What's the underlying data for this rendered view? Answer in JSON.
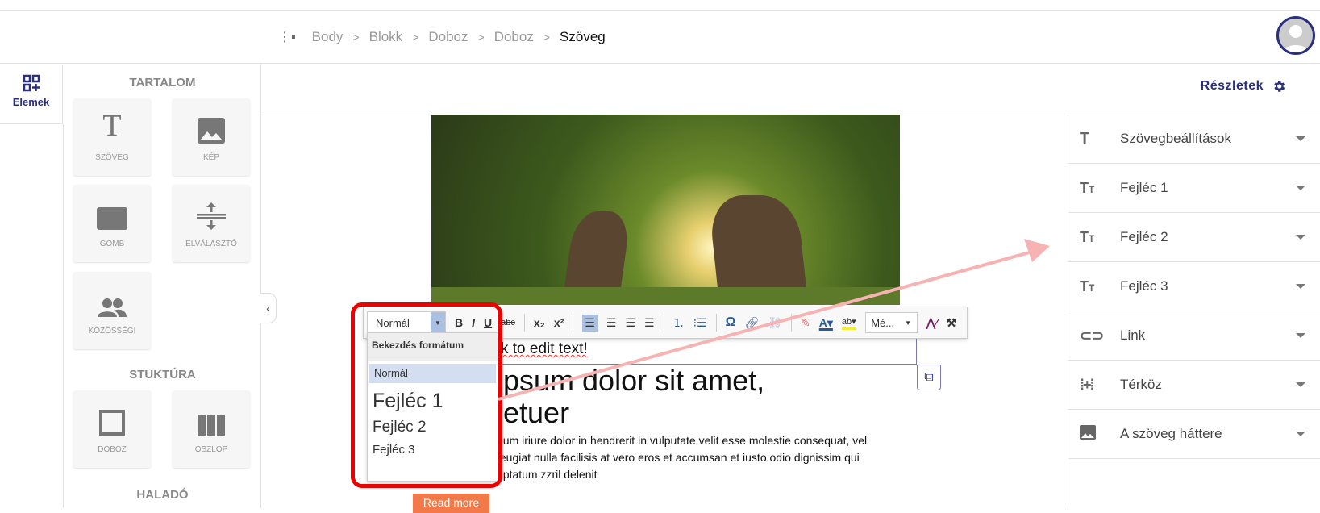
{
  "breadcrumb": {
    "icon": "tree-structure-icon",
    "items": [
      "Body",
      "Blokk",
      "Doboz",
      "Doboz"
    ],
    "current": "Szöveg",
    "separator": ">"
  },
  "left_rail": {
    "elements_label": "Elemek"
  },
  "palette": {
    "sections": [
      "TARTALOM",
      "STUKTÚRA",
      "HALADÓ"
    ],
    "content_tiles": [
      {
        "label": "SZÖVEG",
        "icon": "text-icon"
      },
      {
        "label": "KÉP",
        "icon": "image-icon"
      },
      {
        "label": "GOMB",
        "icon": "button-icon"
      },
      {
        "label": "ELVÁLASZTÓ",
        "icon": "divider-icon"
      },
      {
        "label": "KÖZÖSSÉGI",
        "icon": "people-icon"
      }
    ],
    "structure_tiles": [
      {
        "label": "DOBOZ",
        "icon": "box-icon"
      },
      {
        "label": "OSZLOP",
        "icon": "columns-icon"
      }
    ]
  },
  "details": {
    "label": "Részletek"
  },
  "panel": {
    "rows": [
      {
        "label": "Szövegbeállítások",
        "icon": "text-icon"
      },
      {
        "label": "Fejléc 1",
        "icon": "text-size-icon"
      },
      {
        "label": "Fejléc 2",
        "icon": "text-size-icon"
      },
      {
        "label": "Fejléc 3",
        "icon": "text-size-icon"
      },
      {
        "label": "Link",
        "icon": "link-icon"
      },
      {
        "label": "Térköz",
        "icon": "spacing-icon"
      },
      {
        "label": "A szöveg háttere",
        "icon": "image-icon"
      }
    ]
  },
  "toolbar": {
    "format_value": "Normál",
    "bold": "B",
    "italic": "I",
    "underline": "U",
    "strike": "abc",
    "subscript": "x₂",
    "superscript": "x²",
    "special_char": "Ω",
    "more": "Mé..."
  },
  "format_dropdown": {
    "header": "Bekezdés formátum",
    "options": [
      "Normál",
      "Fejléc 1",
      "Fejléc 2",
      "Fejléc 3"
    ],
    "selected": "Normál"
  },
  "canvas": {
    "edit_text": "k to edit text!",
    "heading_line1": "ipsum dolor sit amet,",
    "heading_line2": "letuer",
    "paragraph": [
      "eum iriure dolor in hendrerit in vulputate velit esse molestie consequat, vel",
      "feugiat nulla facilisis at vero eros et accumsan et iusto odio dignissim qui",
      "uptatum zzril delenit"
    ],
    "button": "Read more"
  },
  "colors": {
    "accent": "#2a2f7e",
    "highlight_box": "#e00000",
    "arrow": "#f7b3b3",
    "button": "#f27a4a"
  }
}
